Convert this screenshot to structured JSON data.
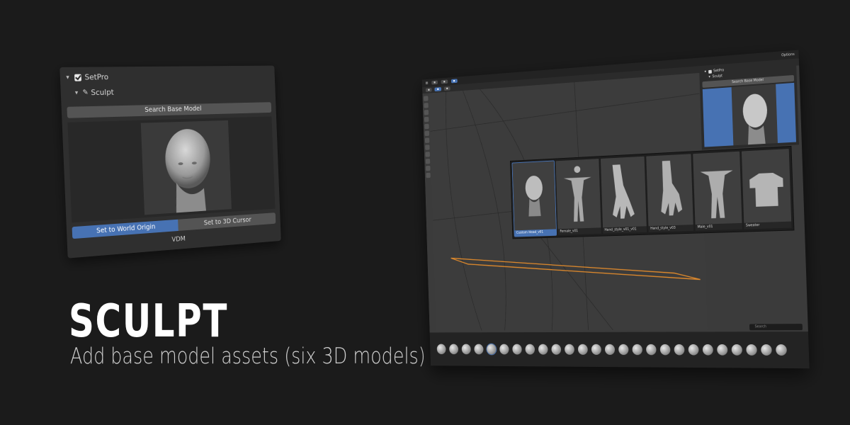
{
  "left_panel": {
    "addon_name": "SetPro",
    "section_name": "Sculpt",
    "search_button": "Search Base Model",
    "segment": {
      "active": "Set to World Origin",
      "inactive": "Set to 3D Cursor"
    },
    "footer_label": "VDM"
  },
  "headline": {
    "title": "SCULPT",
    "subtitle": "Add base model assets (six 3D models)"
  },
  "blender": {
    "n_panel": {
      "addon_name": "SetPro",
      "section_name": "Sculpt",
      "search_button": "Search Base Model"
    },
    "assets": [
      {
        "label": "Custom Head_v01",
        "icon": "head",
        "selected": true
      },
      {
        "label": "Female_v01",
        "icon": "female-body",
        "selected": false
      },
      {
        "label": "Hand_style_v01_v01",
        "icon": "hand",
        "selected": false
      },
      {
        "label": "Hand_style_v03",
        "icon": "hand-2",
        "selected": false
      },
      {
        "label": "Male_v01",
        "icon": "male-body",
        "selected": false
      },
      {
        "label": "Sweater",
        "icon": "sweater",
        "selected": false
      }
    ],
    "search_placeholder": "Search",
    "options_label": "Options",
    "accent": "#4772b3",
    "selection_outline": "#e08a2c"
  }
}
